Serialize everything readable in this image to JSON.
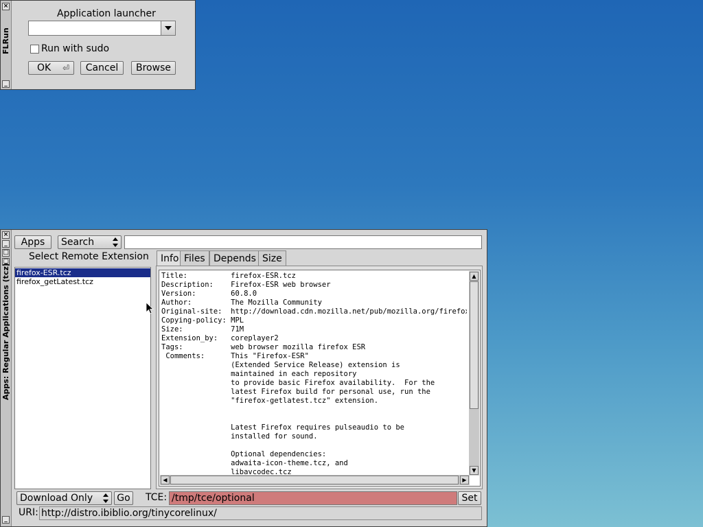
{
  "flrun": {
    "window_title": "FLRun",
    "heading": "Application launcher",
    "command_value": "",
    "sudo_label": "Run with sudo",
    "ok_label": "OK",
    "ok_glyph": "⏎",
    "cancel_label": "Cancel",
    "browse_label": "Browse"
  },
  "apps": {
    "window_title": "Apps: Regular Applications (tcz)",
    "apps_button": "Apps",
    "search_mode": "Search",
    "search_value": "",
    "select_heading": "Select Remote Extension",
    "extensions": [
      "firefox-ESR.tcz",
      "firefox_getLatest.tcz"
    ],
    "selected_extension": "firefox-ESR.tcz",
    "tabs": [
      "Info",
      "Files",
      "Depends",
      "Size"
    ],
    "active_tab": "Info",
    "info_text": "Title:          firefox-ESR.tcz\nDescription:    Firefox-ESR web browser\nVersion:        60.8.0\nAuthor:         The Mozilla Community\nOriginal-site:  http://download.cdn.mozilla.net/pub/mozilla.org/firefox/re\nCopying-policy: MPL\nSize:           71M\nExtension_by:   coreplayer2\nTags:           web browser mozilla firefox ESR\n Comments:      This \"Firefox-ESR\"\n                (Extended Service Release) extension is\n                maintained in each repository\n                to provide basic Firefox availability.  For the\n                latest Firefox build for personal use, run the\n                \"firefox-getlatest.tcz\" extension.\n\n\n                Latest Firefox requires pulseaudio to be\n                installed for sound.\n\n                Optional dependencies:\n                adwaita-icon-theme.tcz, and\n                libavcodec.tcz",
    "download_mode": "Download Only",
    "go_label": "Go",
    "tce_label": "TCE:",
    "tce_value": "/tmp/tce/optional",
    "set_label": "Set",
    "uri_label": "URI:",
    "uri_value": "http://distro.ibiblio.org/tinycorelinux/"
  },
  "colors": {
    "tce_field_bg": "#cf7b7b",
    "selection_bg": "#1a2d8a"
  },
  "icons": {
    "cursor": "arrow-cursor-icon"
  }
}
